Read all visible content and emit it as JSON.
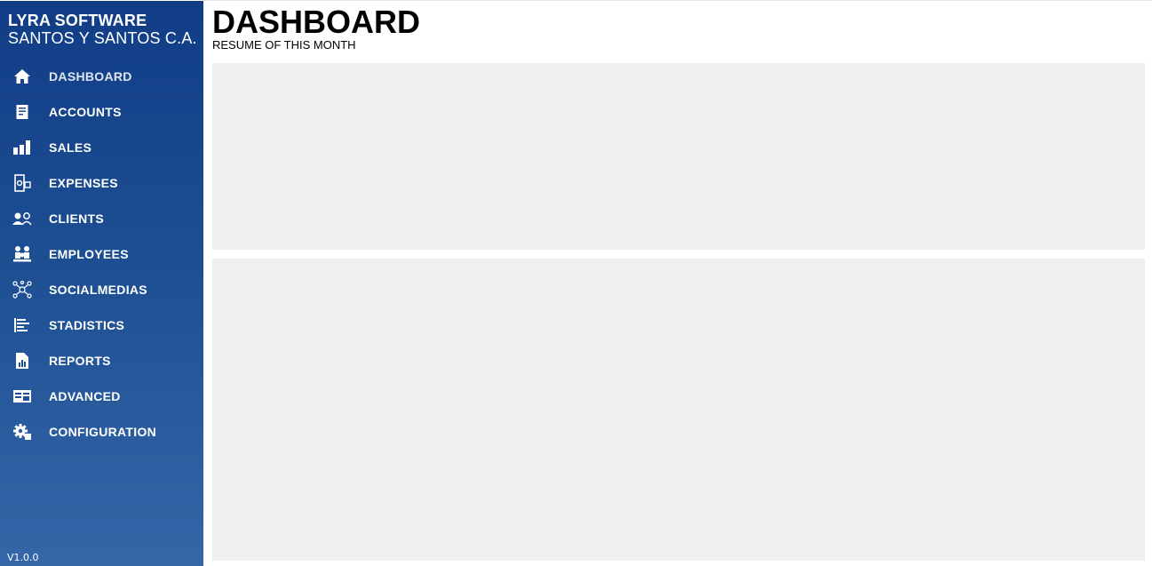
{
  "sidebar": {
    "brand_title": "LYRA SOFTWARE",
    "brand_subtitle": "SANTOS Y SANTOS C.A.",
    "items": [
      {
        "label": "DASHBOARD",
        "icon": "home-icon"
      },
      {
        "label": "ACCOUNTS",
        "icon": "ledger-icon"
      },
      {
        "label": "SALES",
        "icon": "coins-stack-icon"
      },
      {
        "label": "EXPENSES",
        "icon": "expense-icon"
      },
      {
        "label": "CLIENTS",
        "icon": "clients-icon"
      },
      {
        "label": "EMPLOYEES",
        "icon": "employees-icon"
      },
      {
        "label": "SOCIALMEDIAS",
        "icon": "network-icon"
      },
      {
        "label": "STADISTICS",
        "icon": "bar-list-icon"
      },
      {
        "label": "REPORTS",
        "icon": "report-icon"
      },
      {
        "label": "ADVANCED",
        "icon": "panels-icon"
      },
      {
        "label": "CONFIGURATION",
        "icon": "gear-icon"
      }
    ],
    "active_item": "DASHBOARD",
    "version": "V1.0.0"
  },
  "main": {
    "title": "DASHBOARD",
    "subtitle": "RESUME OF THIS MONTH"
  },
  "colors": {
    "sidebar_top": "#113d87",
    "sidebar_bottom": "#3566a8",
    "panel_bg": "#efefef"
  }
}
